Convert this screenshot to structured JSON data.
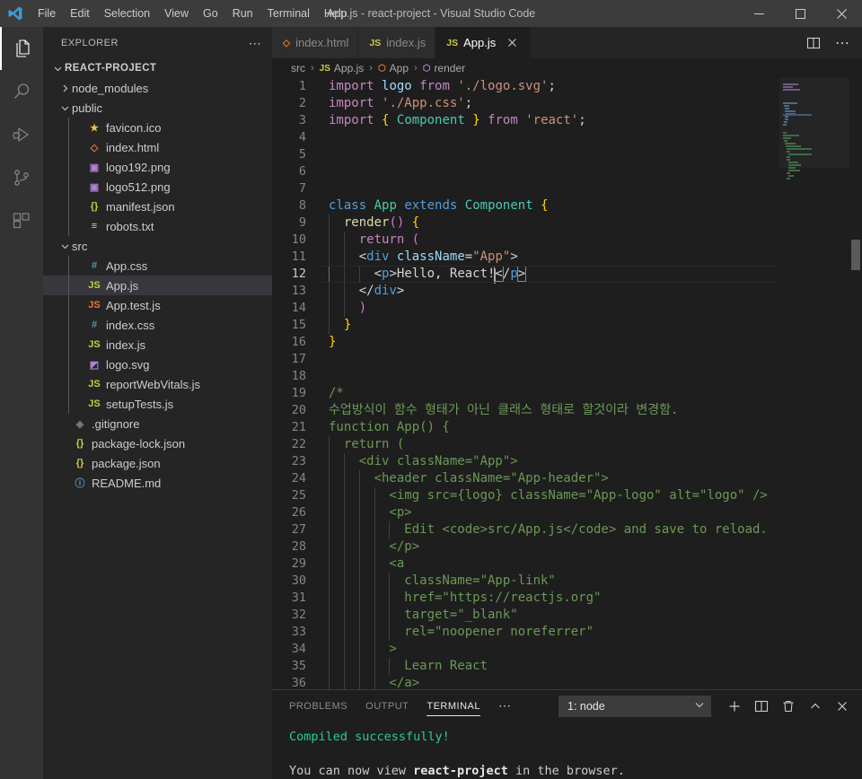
{
  "window": {
    "title": "App.js - react-project - Visual Studio Code",
    "logo_icon": "vscode-logo-icon",
    "minimize_label": "─",
    "maximize_label": "□",
    "close_label": "✕"
  },
  "menubar": {
    "items": [
      {
        "label": "File"
      },
      {
        "label": "Edit"
      },
      {
        "label": "Selection"
      },
      {
        "label": "View"
      },
      {
        "label": "Go"
      },
      {
        "label": "Run"
      },
      {
        "label": "Terminal"
      },
      {
        "label": "Help"
      }
    ]
  },
  "activitybar": {
    "items": [
      {
        "name": "explorer",
        "icon": "files-icon",
        "active": true
      },
      {
        "name": "search",
        "icon": "search-icon",
        "active": false
      },
      {
        "name": "run-and-debug",
        "icon": "run-debug-icon",
        "active": false
      },
      {
        "name": "source-control",
        "icon": "source-control-icon",
        "active": false
      },
      {
        "name": "extensions",
        "icon": "extensions-icon",
        "active": false
      }
    ]
  },
  "sidebar": {
    "header_title": "EXPLORER",
    "more_actions_label": "⋯",
    "root": {
      "label": "REACT-PROJECT",
      "expanded": true
    },
    "tree": [
      {
        "label": "node_modules",
        "type": "folder",
        "expanded": false,
        "indent": 1,
        "icon": "chevron-right-icon",
        "color": "#cccccc"
      },
      {
        "label": "public",
        "type": "folder",
        "expanded": true,
        "indent": 1,
        "icon": "chevron-down-icon",
        "color": "#cccccc"
      },
      {
        "label": "favicon.ico",
        "type": "file",
        "indent": 2,
        "icon": "star-icon",
        "glyph": "★",
        "color": "#e8c547"
      },
      {
        "label": "index.html",
        "type": "file",
        "indent": 2,
        "icon": "html-icon",
        "glyph": "◇",
        "color": "#e37933"
      },
      {
        "label": "logo192.png",
        "type": "file",
        "indent": 2,
        "icon": "image-icon",
        "glyph": "▣",
        "color": "#b180d7"
      },
      {
        "label": "logo512.png",
        "type": "file",
        "indent": 2,
        "icon": "image-icon",
        "glyph": "▣",
        "color": "#b180d7"
      },
      {
        "label": "manifest.json",
        "type": "file",
        "indent": 2,
        "icon": "json-icon",
        "glyph": "{}",
        "color": "#cbcb41"
      },
      {
        "label": "robots.txt",
        "type": "file",
        "indent": 2,
        "icon": "text-icon",
        "glyph": "≡",
        "color": "#cccccc"
      },
      {
        "label": "src",
        "type": "folder",
        "expanded": true,
        "indent": 1,
        "icon": "chevron-down-icon",
        "color": "#cccccc"
      },
      {
        "label": "App.css",
        "type": "file",
        "indent": 2,
        "icon": "css-icon",
        "glyph": "#",
        "color": "#519aba"
      },
      {
        "label": "App.js",
        "type": "file",
        "indent": 2,
        "icon": "js-icon",
        "glyph": "JS",
        "color": "#cbcb41",
        "selected": true
      },
      {
        "label": "App.test.js",
        "type": "file",
        "indent": 2,
        "icon": "js-test-icon",
        "glyph": "JS",
        "color": "#e37933"
      },
      {
        "label": "index.css",
        "type": "file",
        "indent": 2,
        "icon": "css-icon",
        "glyph": "#",
        "color": "#519aba"
      },
      {
        "label": "index.js",
        "type": "file",
        "indent": 2,
        "icon": "js-icon",
        "glyph": "JS",
        "color": "#cbcb41"
      },
      {
        "label": "logo.svg",
        "type": "file",
        "indent": 2,
        "icon": "svg-icon",
        "glyph": "◩",
        "color": "#b180d7"
      },
      {
        "label": "reportWebVitals.js",
        "type": "file",
        "indent": 2,
        "icon": "js-icon",
        "glyph": "JS",
        "color": "#cbcb41"
      },
      {
        "label": "setupTests.js",
        "type": "file",
        "indent": 2,
        "icon": "js-icon",
        "glyph": "JS",
        "color": "#cbcb41"
      },
      {
        "label": ".gitignore",
        "type": "file",
        "indent": 1,
        "icon": "git-icon",
        "glyph": "◈",
        "color": "#6d8086"
      },
      {
        "label": "package-lock.json",
        "type": "file",
        "indent": 1,
        "icon": "json-icon",
        "glyph": "{}",
        "color": "#cbcb41"
      },
      {
        "label": "package.json",
        "type": "file",
        "indent": 1,
        "icon": "json-icon",
        "glyph": "{}",
        "color": "#cbcb41"
      },
      {
        "label": "README.md",
        "type": "file",
        "indent": 1,
        "icon": "info-icon",
        "glyph": "ⓘ",
        "color": "#519aba"
      }
    ]
  },
  "editor": {
    "tabs": [
      {
        "label": "index.html",
        "icon": "html-icon",
        "glyph": "◇",
        "color": "#e37933",
        "active": false,
        "closable": false
      },
      {
        "label": "index.js",
        "icon": "js-icon",
        "glyph": "JS",
        "color": "#cbcb41",
        "active": false,
        "closable": false
      },
      {
        "label": "App.js",
        "icon": "js-icon",
        "glyph": "JS",
        "color": "#cbcb41",
        "active": true,
        "closable": true,
        "close_label": "✕"
      }
    ],
    "tab_actions": [
      {
        "name": "split-editor-right",
        "icon": "split-editor-icon"
      },
      {
        "name": "more-editor-actions",
        "icon": "ellipsis-icon",
        "glyph": "⋯"
      }
    ],
    "breadcrumb": [
      {
        "label": "src",
        "icon": null
      },
      {
        "label": "App.js",
        "icon": "js-icon",
        "glyph": "JS",
        "color": "#cbcb41"
      },
      {
        "label": "App",
        "icon": "class-icon",
        "glyph": "⬡",
        "color": "#e37933"
      },
      {
        "label": "render",
        "icon": "method-icon",
        "glyph": "⬡",
        "color": "#b180d7"
      }
    ],
    "breadcrumb_separator": "›",
    "active_line": 12,
    "first_line": 1,
    "last_visible_line": 36,
    "lines": [
      {
        "n": 1,
        "text": "import logo from './logo.svg';"
      },
      {
        "n": 2,
        "text": "import './App.css';"
      },
      {
        "n": 3,
        "text": "import { Component } from 'react';"
      },
      {
        "n": 4,
        "text": ""
      },
      {
        "n": 5,
        "text": ""
      },
      {
        "n": 6,
        "text": ""
      },
      {
        "n": 7,
        "text": ""
      },
      {
        "n": 8,
        "text": "class App extends Component {"
      },
      {
        "n": 9,
        "text": "  render() {"
      },
      {
        "n": 10,
        "text": "    return ("
      },
      {
        "n": 11,
        "text": "    <div className=\"App\">"
      },
      {
        "n": 12,
        "text": "      <p>Hello, React!</p>"
      },
      {
        "n": 13,
        "text": "    </div>"
      },
      {
        "n": 14,
        "text": "    )"
      },
      {
        "n": 15,
        "text": "  }"
      },
      {
        "n": 16,
        "text": "}"
      },
      {
        "n": 17,
        "text": ""
      },
      {
        "n": 18,
        "text": ""
      },
      {
        "n": 19,
        "text": "/*"
      },
      {
        "n": 20,
        "text": "수업방식이 함수 형태가 아닌 클래스 형태로 할것이라 변경함."
      },
      {
        "n": 21,
        "text": "function App() {"
      },
      {
        "n": 22,
        "text": "  return ("
      },
      {
        "n": 23,
        "text": "    <div className=\"App\">"
      },
      {
        "n": 24,
        "text": "      <header className=\"App-header\">"
      },
      {
        "n": 25,
        "text": "        <img src={logo} className=\"App-logo\" alt=\"logo\" />"
      },
      {
        "n": 26,
        "text": "        <p>"
      },
      {
        "n": 27,
        "text": "          Edit <code>src/App.js</code> and save to reload."
      },
      {
        "n": 28,
        "text": "        </p>"
      },
      {
        "n": 29,
        "text": "        <a"
      },
      {
        "n": 30,
        "text": "          className=\"App-link\""
      },
      {
        "n": 31,
        "text": "          href=\"https://reactjs.org\""
      },
      {
        "n": 32,
        "text": "          target=\"_blank\""
      },
      {
        "n": 33,
        "text": "          rel=\"noopener noreferrer\""
      },
      {
        "n": 34,
        "text": "        >"
      },
      {
        "n": 35,
        "text": "          Learn React"
      },
      {
        "n": 36,
        "text": "        </a>"
      }
    ]
  },
  "panel": {
    "tabs": [
      {
        "label": "PROBLEMS",
        "active": false
      },
      {
        "label": "OUTPUT",
        "active": false
      },
      {
        "label": "TERMINAL",
        "active": true
      }
    ],
    "more_label": "⋯",
    "terminal_select": {
      "value": "1: node",
      "chevron": "⌄"
    },
    "actions": [
      {
        "name": "new-terminal",
        "icon": "plus-icon",
        "glyph": "＋"
      },
      {
        "name": "split-terminal",
        "icon": "split-icon"
      },
      {
        "name": "kill-terminal",
        "icon": "trash-icon"
      },
      {
        "name": "maximize-panel",
        "icon": "chevron-up-icon",
        "glyph": "⌃"
      },
      {
        "name": "close-panel",
        "icon": "close-icon",
        "glyph": "✕"
      }
    ],
    "terminal_output": [
      {
        "text": "Compiled successfully!",
        "style": "green"
      },
      {
        "text": "",
        "style": "plain"
      },
      {
        "text": "You can now view react-project in the browser.",
        "style": "mixed",
        "bold_part": "react-project"
      }
    ]
  },
  "colors": {
    "titlebar_bg": "#3c3c3c",
    "activitybar_bg": "#333333",
    "sidebar_bg": "#252526",
    "editor_bg": "#1e1e1e",
    "tab_inactive_bg": "#2d2d2d",
    "accent_blue": "#0e639c",
    "selected_row_bg": "#37373d",
    "terminal_green": "#23d18b"
  }
}
